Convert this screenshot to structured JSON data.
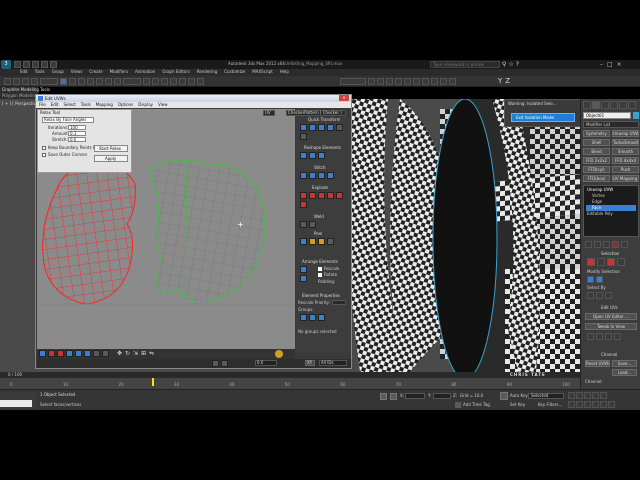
{
  "app": {
    "title": "Autodesk 3ds Max  2012 x64",
    "file": "Unfolding_Mapping_SRt.max",
    "search_placeholder": "Type a keyword or phrase"
  },
  "menubar": {
    "items": [
      "Edit",
      "Tools",
      "Group",
      "Views",
      "Create",
      "Modifiers",
      "Animation",
      "Graph Editors",
      "Rendering",
      "Customize",
      "MAXScript",
      "Help"
    ]
  },
  "ribbon": {
    "graphite_label": "Graphite Modeling Tools",
    "sub_label": "Polygon Modeling"
  },
  "viewport": {
    "label": "[ + ] [ Perspective ] [ Smooth + Highlights ]"
  },
  "warning": {
    "title": "Warning: Isolated Sele...",
    "button_label": "Exit Isolation Mode"
  },
  "uvw_editor": {
    "title": "Edit UVWs",
    "menu": [
      "File",
      "Edit",
      "Select",
      "Tools",
      "Mapping",
      "Options",
      "Display",
      "View"
    ],
    "relax_tool": {
      "title": "Relax Tool",
      "method": "Relax By Face Angles",
      "iterations_label": "Iterations:",
      "iterations_value": "100",
      "amount_label": "Amount:",
      "amount_value": "0.1",
      "stretch_label": "Stretch:",
      "stretch_value": "0.0",
      "keep_boundary": "Keep Boundary Points Fixed",
      "save_outer": "Save Outer Corners",
      "start_relax": "Start Relax",
      "apply": "Apply"
    },
    "uv_dropdown": "UV",
    "checker_dropdown": "CheckerPattern ( Checker )",
    "sections": {
      "quick_transform": "Quick Transform",
      "reshape_elements": "Reshape Elements",
      "stitch": "Stitch",
      "explode": "Explode",
      "weld": "Weld",
      "peel": "Peel",
      "arrange_elements": "Arrange Elements",
      "rescale": "Rescale",
      "rotate": "Rotate",
      "padding": "Padding:",
      "element_properties": "Element Properties",
      "rescale_priority": "Rescale Priority:",
      "groups": "Groups:",
      "no_groups": "No groups selected"
    },
    "status": {
      "xy": "XY",
      "value": "0.0",
      "allids": "All IDs"
    }
  },
  "command_panel": {
    "object_name": "Object01",
    "modifier_list": "Modifier List",
    "buttons": [
      "Symmetry",
      "Unwrap UVW",
      "Shell",
      "TurboSmooth",
      "Bend",
      "Smooth",
      "FFD 2x2x2",
      "FFD 4x4x4",
      "FFD(cyl)",
      "Push",
      "FFD(box)",
      "UV Mapping Cle..."
    ],
    "stack": [
      "Unwrap UVW",
      "Vertex",
      "Edge",
      "Face",
      "Editable Poly"
    ],
    "selection_label": "Selection",
    "modify_selection_label": "Modify Selection",
    "select_by_label": "Select By",
    "edit_uvs_label": "Edit UVs",
    "open_uv_editor": "Open UV Editor ...",
    "tweak_in_view": "Tweak In View",
    "channel_label": "Channel",
    "reset_uvws": "Reset UVWs",
    "save": "Save...",
    "load": "Load...",
    "channel_field": "Channel:"
  },
  "timeline": {
    "frame": "0 / 100",
    "ticks": [
      "0",
      "10",
      "20",
      "30",
      "40",
      "50",
      "60",
      "70",
      "80",
      "90",
      "100"
    ],
    "watermark": "CHRIS TATE"
  },
  "statusbar": {
    "selected": "1 Object Selected",
    "prompt": "Select faces/vertices",
    "x_label": "X:",
    "y_label": "Y:",
    "z_label": "Z:",
    "grid": "Grid = 10.0",
    "auto_key": "Auto Key",
    "set_key": "Set Key",
    "selected_dd": "Selected",
    "key_filters": "Key Filters...",
    "add_time_tag": "Add Time Tag"
  },
  "colors": {
    "uv_background": "#8b8b8b",
    "selected_uv": "#ff2020",
    "unselected_uv": "#909090",
    "uv_boundary": "#3fbf3f",
    "accent_blue": "#1e7fd6"
  }
}
